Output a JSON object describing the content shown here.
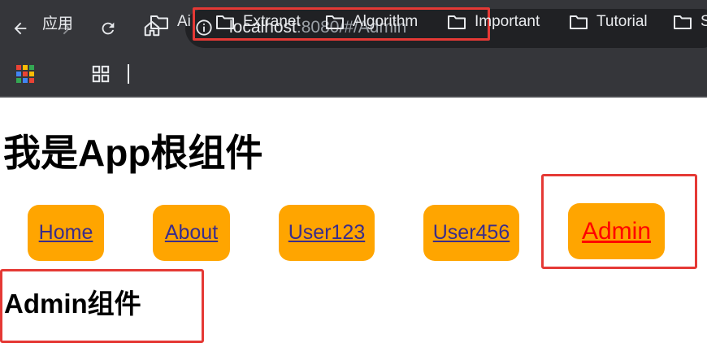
{
  "browser": {
    "url_host": "localhost",
    "url_rest": ":8080/#/Admin",
    "bookmarks": [
      {
        "label": "应用"
      },
      {
        "label": "Ai"
      },
      {
        "label": "Extranet"
      },
      {
        "label": "Algorithm"
      },
      {
        "label": "Important"
      },
      {
        "label": "Tutorial"
      },
      {
        "label": "S"
      }
    ],
    "icons": {
      "back": "back-arrow-icon",
      "forward": "forward-arrow-icon",
      "reload": "reload-icon",
      "home": "home-icon",
      "info": "info-icon",
      "folder": "folder-icon",
      "apps": "apps-icon"
    },
    "colors": {
      "toolbar": "#35363a",
      "omnibox": "#202124",
      "highlight_box": "#e53935"
    }
  },
  "page": {
    "title": "我是App根组件",
    "nav": [
      {
        "label": "Home",
        "active": false
      },
      {
        "label": "About",
        "active": false
      },
      {
        "label": "User123",
        "active": false
      },
      {
        "label": "User456",
        "active": false
      },
      {
        "label": "Admin",
        "active": true
      }
    ],
    "content_heading": "Admin组件",
    "colors": {
      "link_bg": "#ffa500",
      "link_text": "#3b2d8a",
      "active_link_text": "#ff0000"
    }
  }
}
